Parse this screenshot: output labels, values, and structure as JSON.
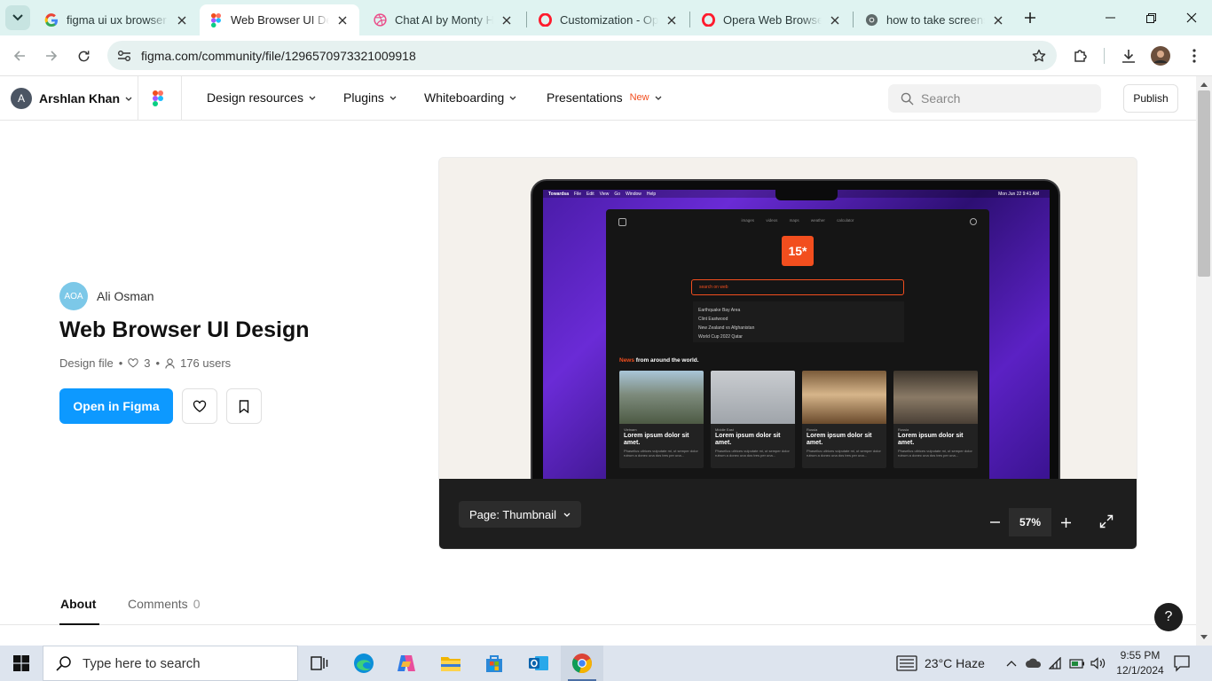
{
  "browser": {
    "tabs": [
      {
        "title": "figma ui ux browser design - Google Search",
        "favicon": "google-icon",
        "active": false
      },
      {
        "title": "Web Browser UI Design | Figma",
        "favicon": "figma-icon",
        "active": true
      },
      {
        "title": "Chat AI by Monty Hayton",
        "favicon": "dribbble-icon",
        "active": false
      },
      {
        "title": "Customization - Opera",
        "favicon": "opera-icon",
        "active": false
      },
      {
        "title": "Opera Web Browser | Faster",
        "favicon": "opera-icon",
        "active": false
      },
      {
        "title": "how to take screenshot",
        "favicon": "chrome-icon",
        "active": false
      }
    ],
    "url": "figma.com/community/file/1296570973321009918"
  },
  "figma": {
    "account_initial": "A",
    "account_name": "Arshlan Khan",
    "nav": {
      "design_resources": "Design resources",
      "plugins": "Plugins",
      "whiteboarding": "Whiteboarding",
      "presentations": "Presentations",
      "new_badge": "New"
    },
    "search_placeholder": "Search",
    "publish_label": "Publish"
  },
  "file": {
    "author_avatar_text": "AOA",
    "author": "Ali Osman",
    "title": "Web Browser UI Design",
    "type": "Design file",
    "likes": "3",
    "users": "176 users",
    "open_label": "Open in Figma"
  },
  "preview": {
    "page_label": "Page: Thumbnail",
    "zoom": "57%",
    "mock": {
      "menubar": [
        "Towardsa",
        "File",
        "Edit",
        "View",
        "Go",
        "Window",
        "Help"
      ],
      "menubar_right": "Mon Jun 22  9:41 AM",
      "nav": [
        "images",
        "videos",
        "maps",
        "weather",
        "calculator"
      ],
      "temperature": "15*",
      "search_placeholder": "search on web",
      "suggestions": [
        "Earthquake Bay Area",
        "Clint Eastwood",
        "New Zealand vs Afghanistan",
        "World Cup 2022 Qatar"
      ],
      "news_accent": "News",
      "news_rest": " from around the world.",
      "cards": [
        {
          "category": "Vietnam",
          "headline": "Lorem ipsum dolor sit amet.",
          "body": "Phasellus ultrices vulputate mi, ut semper dolor rutrum a donec una dos tres per una..."
        },
        {
          "category": "Middle East",
          "headline": "Lorem ipsum dolor sit amet.",
          "body": "Phasellus ultrices vulputate mi, ut semper dolor rutrum a donec una dos tres per una..."
        },
        {
          "category": "Russia",
          "headline": "Lorem ipsum dolor sit amet.",
          "body": "Phasellus ultrices vulputate mi, ut semper dolor rutrum a donec una dos tres per una..."
        },
        {
          "category": "Russia",
          "headline": "Lorem ipsum dolor sit amet.",
          "body": "Phasellus ultrices vulputate mi, ut semper dolor rutrum a donec una dos tres per una..."
        }
      ]
    }
  },
  "content_tabs": {
    "about": "About",
    "comments": "Comments",
    "comments_count": "0"
  },
  "help_label": "?",
  "taskbar": {
    "search_placeholder": "Type here to search",
    "weather": "23°C  Haze",
    "time": "9:55 PM",
    "date": "12/1/2024"
  },
  "colors": {
    "figma_blue": "#0d99ff",
    "accent_orange": "#f24e1e",
    "tabstrip_bg": "#dff3f1"
  }
}
